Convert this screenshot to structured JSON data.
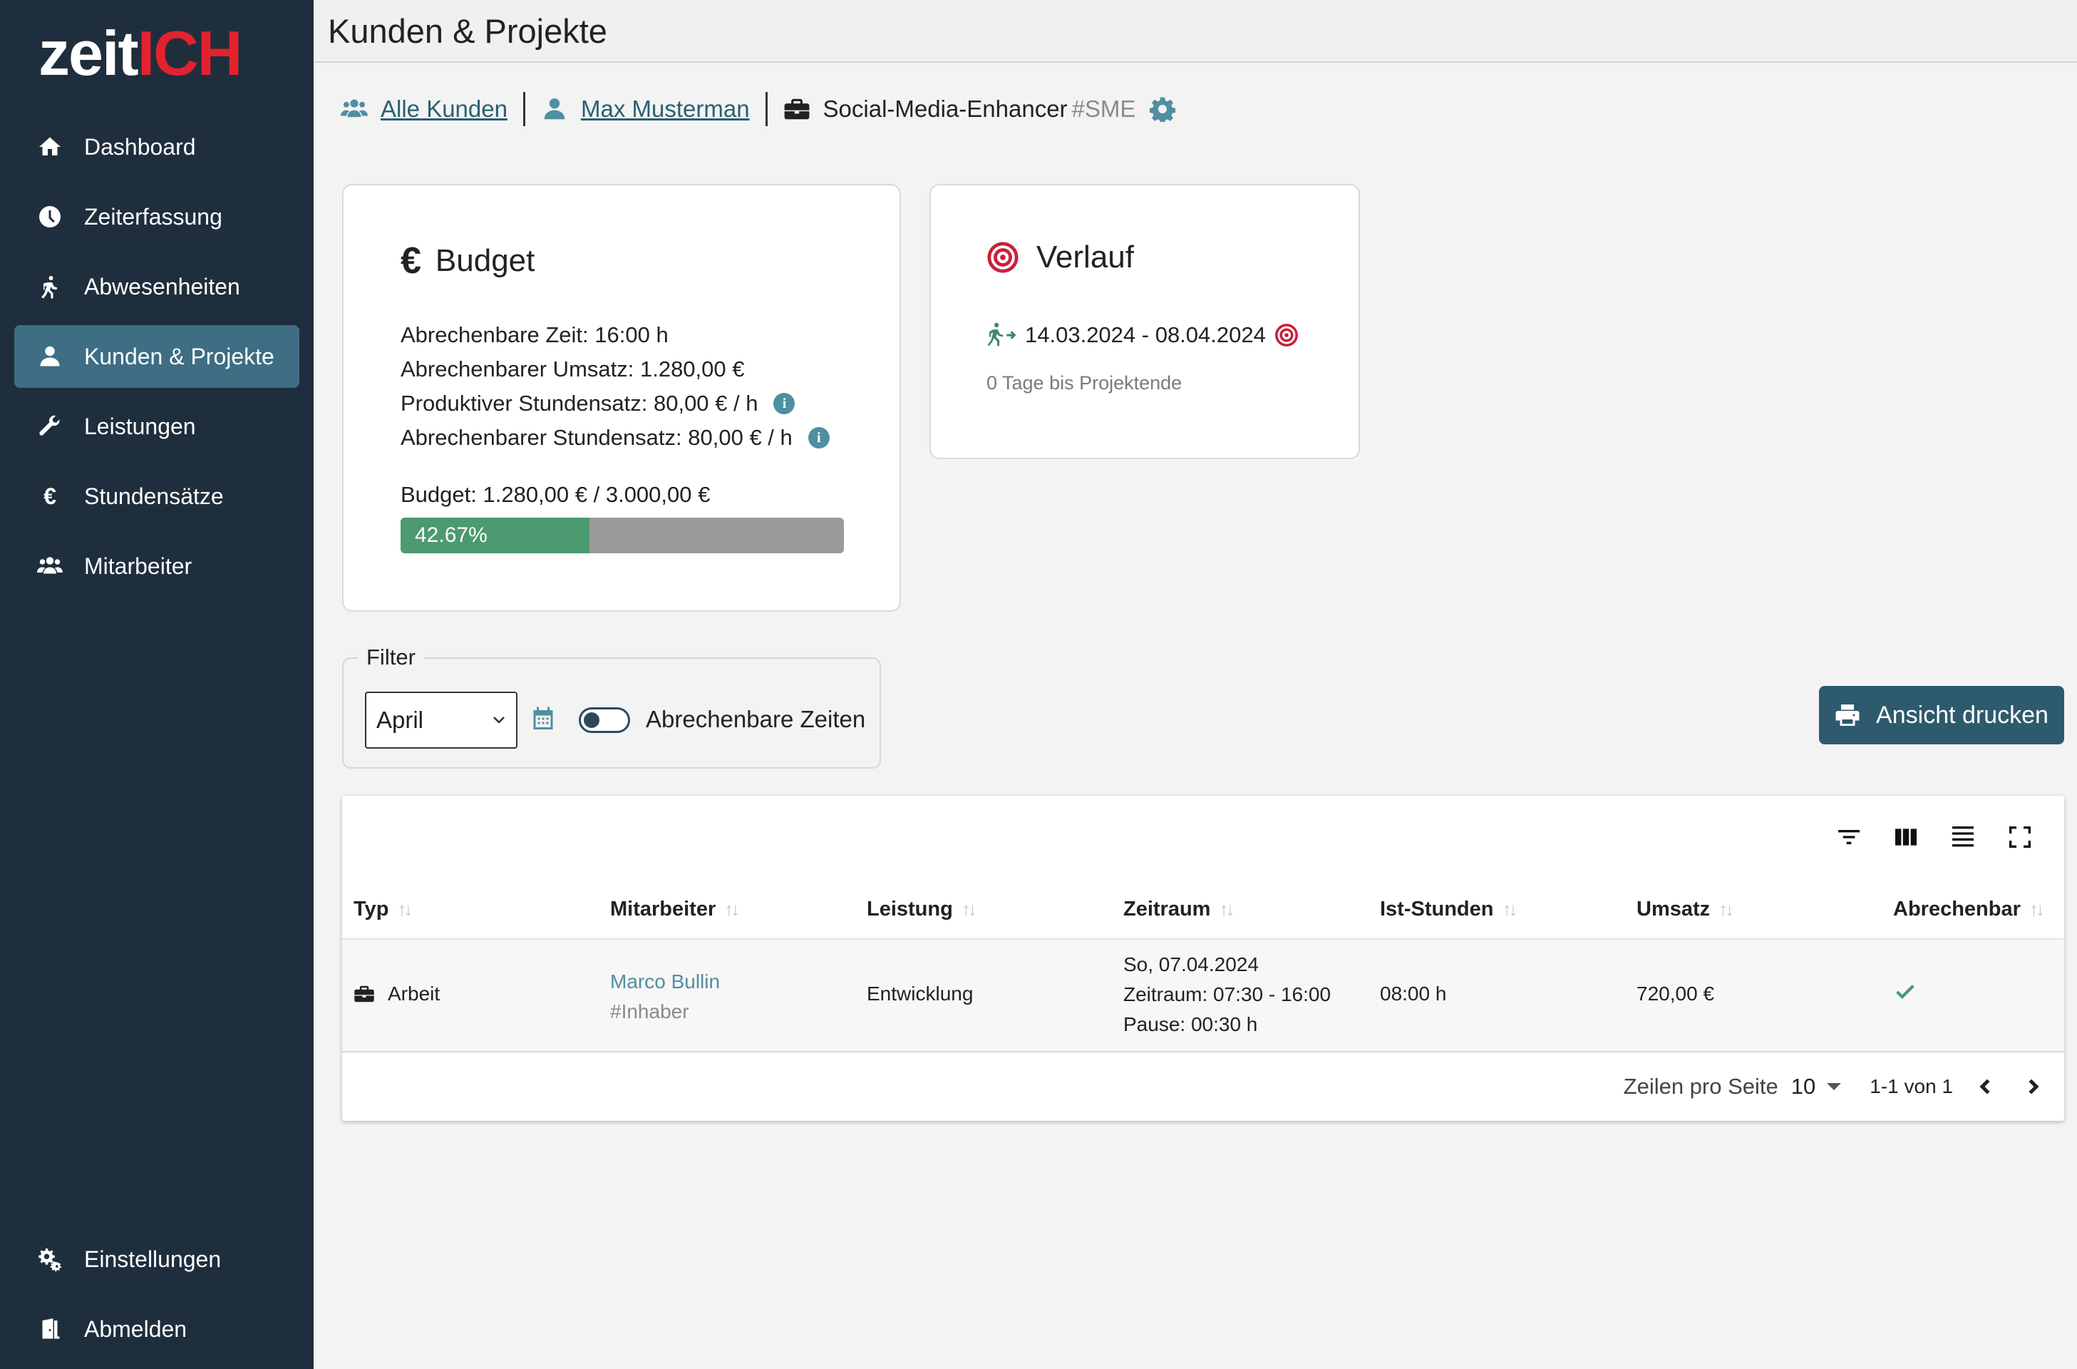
{
  "app": {
    "logo_part1": "zeit",
    "logo_part2": "ICH",
    "colors": {
      "sidebar": "#1f2e3d",
      "active": "#3e6d84",
      "accent": "#4f8fa1",
      "brand_red": "#e3222e",
      "success": "#4c9a6f",
      "button": "#2e5a6e"
    }
  },
  "sidebar": {
    "items": [
      {
        "label": "Dashboard",
        "icon": "home-icon"
      },
      {
        "label": "Zeiterfassung",
        "icon": "clock-icon"
      },
      {
        "label": "Abwesenheiten",
        "icon": "walking-icon"
      },
      {
        "label": "Kunden & Projekte",
        "icon": "user-icon",
        "active": true
      },
      {
        "label": "Leistungen",
        "icon": "wrench-icon"
      },
      {
        "label": "Stundensätze",
        "icon": "euro-icon"
      },
      {
        "label": "Mitarbeiter",
        "icon": "users-icon"
      }
    ],
    "bottom": [
      {
        "label": "Einstellungen",
        "icon": "gears-icon"
      },
      {
        "label": "Abmelden",
        "icon": "door-icon"
      }
    ]
  },
  "header": {
    "title": "Kunden & Projekte"
  },
  "breadcrumb": {
    "all_customers": "Alle Kunden",
    "customer": "Max Musterman",
    "project": "Social-Media-Enhancer",
    "project_code": "#SME"
  },
  "budget": {
    "title": "Budget",
    "lines": [
      "Abrechenbare Zeit: 16:00 h",
      "Abrechenbarer Umsatz: 1.280,00 €",
      "Produktiver Stundensatz: 80,00 € / h",
      "Abrechenbarer Stundensatz: 80,00 € / h"
    ],
    "total": "Budget: 1.280,00 € / 3.000,00 €",
    "progress_label": "42.67%",
    "progress": 0.4267
  },
  "verlauf": {
    "title": "Verlauf",
    "dates": "14.03.2024 - 08.04.2024",
    "note": "0 Tage bis Projektende"
  },
  "filter": {
    "legend": "Filter",
    "month": "April",
    "toggle_label": "Abrechenbare Zeiten"
  },
  "print_button": "Ansicht drucken",
  "table": {
    "headers": [
      "Typ",
      "Mitarbeiter",
      "Leistung",
      "Zeitraum",
      "Ist-Stunden",
      "Umsatz",
      "Abrechenbar"
    ],
    "row": {
      "typ": "Arbeit",
      "name": "Marco Bullin",
      "role": "#Inhaber",
      "leistung": "Entwicklung",
      "zeitraum_date": "So, 07.04.2024",
      "zeitraum_time": "Zeitraum: 07:30 - 16:00",
      "zeitraum_pause": "Pause: 00:30 h",
      "ist": "08:00 h",
      "umsatz": "720,00 €"
    },
    "footer": {
      "rows_per_page_label": "Zeilen pro Seite",
      "rows_per_page": "10",
      "range": "1-1 von 1"
    }
  }
}
